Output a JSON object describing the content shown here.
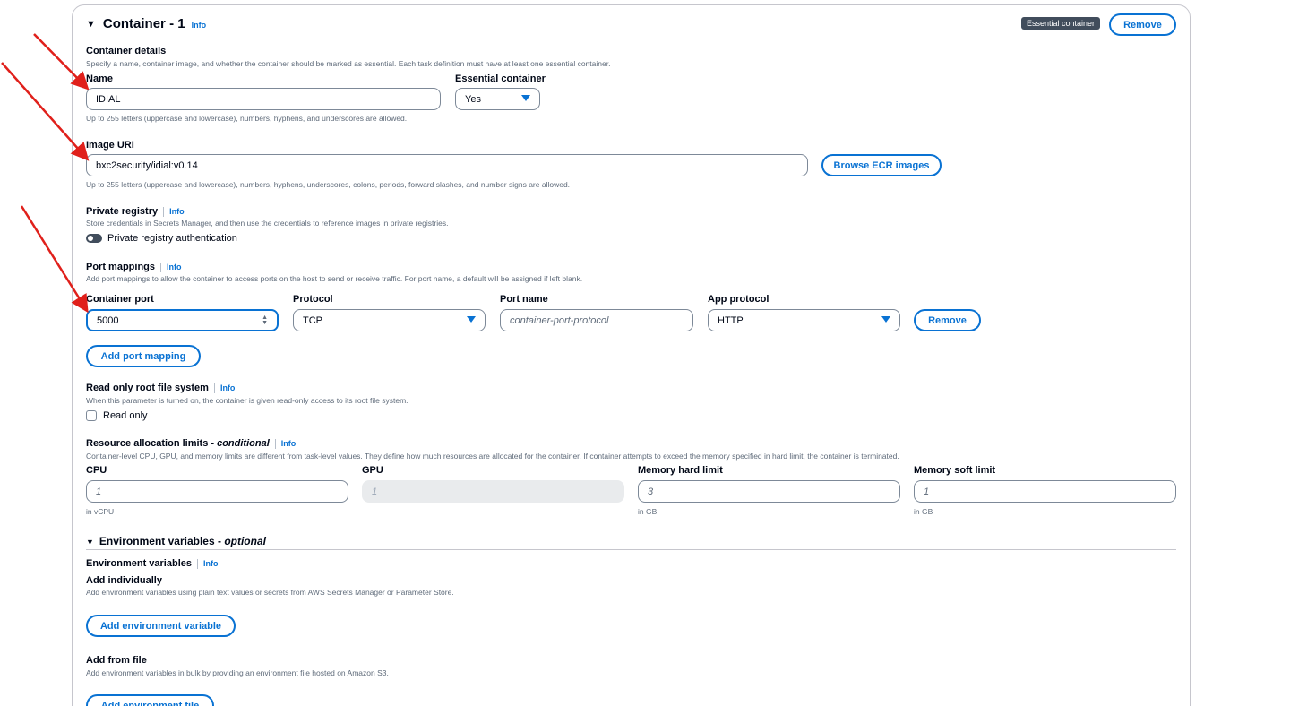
{
  "header": {
    "title": "Container - 1",
    "info": "Info",
    "badge": "Essential container",
    "remove_label": "Remove"
  },
  "container_details": {
    "title": "Container details",
    "description": "Specify a name, container image, and whether the container should be marked as essential. Each task definition must have at least one essential container.",
    "name_label": "Name",
    "name_value": "IDIAL",
    "name_hint": "Up to 255 letters (uppercase and lowercase), numbers, hyphens, and underscores are allowed.",
    "essential_label": "Essential container",
    "essential_value": "Yes"
  },
  "image": {
    "label": "Image URI",
    "value": "bxc2security/idial:v0.14",
    "browse_label": "Browse ECR images",
    "hint": "Up to 255 letters (uppercase and lowercase), numbers, hyphens, underscores, colons, periods, forward slashes, and number signs are allowed."
  },
  "private_registry": {
    "title": "Private registry",
    "info": "Info",
    "description": "Store credentials in Secrets Manager, and then use the credentials to reference images in private registries.",
    "toggle_label": "Private registry authentication"
  },
  "port_mappings": {
    "title": "Port mappings",
    "info": "Info",
    "description": "Add port mappings to allow the container to access ports on the host to send or receive traffic. For port name, a default will be assigned if left blank.",
    "container_port_label": "Container port",
    "container_port_value": "5000",
    "protocol_label": "Protocol",
    "protocol_value": "TCP",
    "port_name_label": "Port name",
    "port_name_placeholder": "container-port-protocol",
    "app_protocol_label": "App protocol",
    "app_protocol_value": "HTTP",
    "remove_label": "Remove",
    "add_label": "Add port mapping"
  },
  "readonly": {
    "title": "Read only root file system",
    "info": "Info",
    "description": "When this parameter is turned on, the container is given read-only access to its root file system.",
    "checkbox_label": "Read only"
  },
  "resources": {
    "title_prefix": "Resource allocation limits - ",
    "title_suffix": "conditional",
    "info": "Info",
    "description": "Container-level CPU, GPU, and memory limits are different from task-level values. They define how much resources are allocated for the container. If container attempts to exceed the memory specified in hard limit, the container is terminated.",
    "cpu_label": "CPU",
    "cpu_placeholder": "1",
    "cpu_hint": "in vCPU",
    "gpu_label": "GPU",
    "gpu_placeholder": "1",
    "mem_hard_label": "Memory hard limit",
    "mem_hard_placeholder": "3",
    "mem_hard_hint": "in GB",
    "mem_soft_label": "Memory soft limit",
    "mem_soft_placeholder": "1",
    "mem_soft_hint": "in GB"
  },
  "env": {
    "section_prefix": "Environment variables - ",
    "section_suffix": "optional",
    "sub_title": "Environment variables",
    "info": "Info",
    "individual_title": "Add individually",
    "individual_desc": "Add environment variables using plain text values or secrets from AWS Secrets Manager or Parameter Store.",
    "add_var_label": "Add environment variable",
    "file_title": "Add from file",
    "file_desc": "Add environment variables in bulk by providing an environment file hosted on Amazon S3.",
    "add_file_label": "Add environment file"
  },
  "colors": {
    "accent": "#0972d3",
    "annotation_arrow": "#e0201b"
  }
}
